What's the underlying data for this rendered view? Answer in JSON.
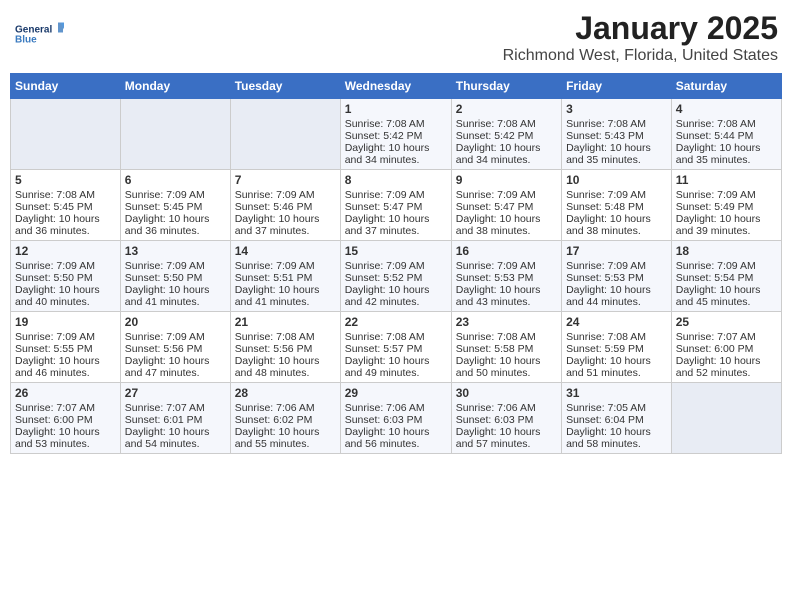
{
  "header": {
    "logo_line1": "General",
    "logo_line2": "Blue",
    "month_title": "January 2025",
    "location": "Richmond West, Florida, United States"
  },
  "weekdays": [
    "Sunday",
    "Monday",
    "Tuesday",
    "Wednesday",
    "Thursday",
    "Friday",
    "Saturday"
  ],
  "weeks": [
    [
      {
        "day": "",
        "content": ""
      },
      {
        "day": "",
        "content": ""
      },
      {
        "day": "",
        "content": ""
      },
      {
        "day": "1",
        "content": "Sunrise: 7:08 AM\nSunset: 5:42 PM\nDaylight: 10 hours\nand 34 minutes."
      },
      {
        "day": "2",
        "content": "Sunrise: 7:08 AM\nSunset: 5:42 PM\nDaylight: 10 hours\nand 34 minutes."
      },
      {
        "day": "3",
        "content": "Sunrise: 7:08 AM\nSunset: 5:43 PM\nDaylight: 10 hours\nand 35 minutes."
      },
      {
        "day": "4",
        "content": "Sunrise: 7:08 AM\nSunset: 5:44 PM\nDaylight: 10 hours\nand 35 minutes."
      }
    ],
    [
      {
        "day": "5",
        "content": "Sunrise: 7:08 AM\nSunset: 5:45 PM\nDaylight: 10 hours\nand 36 minutes."
      },
      {
        "day": "6",
        "content": "Sunrise: 7:09 AM\nSunset: 5:45 PM\nDaylight: 10 hours\nand 36 minutes."
      },
      {
        "day": "7",
        "content": "Sunrise: 7:09 AM\nSunset: 5:46 PM\nDaylight: 10 hours\nand 37 minutes."
      },
      {
        "day": "8",
        "content": "Sunrise: 7:09 AM\nSunset: 5:47 PM\nDaylight: 10 hours\nand 37 minutes."
      },
      {
        "day": "9",
        "content": "Sunrise: 7:09 AM\nSunset: 5:47 PM\nDaylight: 10 hours\nand 38 minutes."
      },
      {
        "day": "10",
        "content": "Sunrise: 7:09 AM\nSunset: 5:48 PM\nDaylight: 10 hours\nand 38 minutes."
      },
      {
        "day": "11",
        "content": "Sunrise: 7:09 AM\nSunset: 5:49 PM\nDaylight: 10 hours\nand 39 minutes."
      }
    ],
    [
      {
        "day": "12",
        "content": "Sunrise: 7:09 AM\nSunset: 5:50 PM\nDaylight: 10 hours\nand 40 minutes."
      },
      {
        "day": "13",
        "content": "Sunrise: 7:09 AM\nSunset: 5:50 PM\nDaylight: 10 hours\nand 41 minutes."
      },
      {
        "day": "14",
        "content": "Sunrise: 7:09 AM\nSunset: 5:51 PM\nDaylight: 10 hours\nand 41 minutes."
      },
      {
        "day": "15",
        "content": "Sunrise: 7:09 AM\nSunset: 5:52 PM\nDaylight: 10 hours\nand 42 minutes."
      },
      {
        "day": "16",
        "content": "Sunrise: 7:09 AM\nSunset: 5:53 PM\nDaylight: 10 hours\nand 43 minutes."
      },
      {
        "day": "17",
        "content": "Sunrise: 7:09 AM\nSunset: 5:53 PM\nDaylight: 10 hours\nand 44 minutes."
      },
      {
        "day": "18",
        "content": "Sunrise: 7:09 AM\nSunset: 5:54 PM\nDaylight: 10 hours\nand 45 minutes."
      }
    ],
    [
      {
        "day": "19",
        "content": "Sunrise: 7:09 AM\nSunset: 5:55 PM\nDaylight: 10 hours\nand 46 minutes."
      },
      {
        "day": "20",
        "content": "Sunrise: 7:09 AM\nSunset: 5:56 PM\nDaylight: 10 hours\nand 47 minutes."
      },
      {
        "day": "21",
        "content": "Sunrise: 7:08 AM\nSunset: 5:56 PM\nDaylight: 10 hours\nand 48 minutes."
      },
      {
        "day": "22",
        "content": "Sunrise: 7:08 AM\nSunset: 5:57 PM\nDaylight: 10 hours\nand 49 minutes."
      },
      {
        "day": "23",
        "content": "Sunrise: 7:08 AM\nSunset: 5:58 PM\nDaylight: 10 hours\nand 50 minutes."
      },
      {
        "day": "24",
        "content": "Sunrise: 7:08 AM\nSunset: 5:59 PM\nDaylight: 10 hours\nand 51 minutes."
      },
      {
        "day": "25",
        "content": "Sunrise: 7:07 AM\nSunset: 6:00 PM\nDaylight: 10 hours\nand 52 minutes."
      }
    ],
    [
      {
        "day": "26",
        "content": "Sunrise: 7:07 AM\nSunset: 6:00 PM\nDaylight: 10 hours\nand 53 minutes."
      },
      {
        "day": "27",
        "content": "Sunrise: 7:07 AM\nSunset: 6:01 PM\nDaylight: 10 hours\nand 54 minutes."
      },
      {
        "day": "28",
        "content": "Sunrise: 7:06 AM\nSunset: 6:02 PM\nDaylight: 10 hours\nand 55 minutes."
      },
      {
        "day": "29",
        "content": "Sunrise: 7:06 AM\nSunset: 6:03 PM\nDaylight: 10 hours\nand 56 minutes."
      },
      {
        "day": "30",
        "content": "Sunrise: 7:06 AM\nSunset: 6:03 PM\nDaylight: 10 hours\nand 57 minutes."
      },
      {
        "day": "31",
        "content": "Sunrise: 7:05 AM\nSunset: 6:04 PM\nDaylight: 10 hours\nand 58 minutes."
      },
      {
        "day": "",
        "content": ""
      }
    ]
  ]
}
